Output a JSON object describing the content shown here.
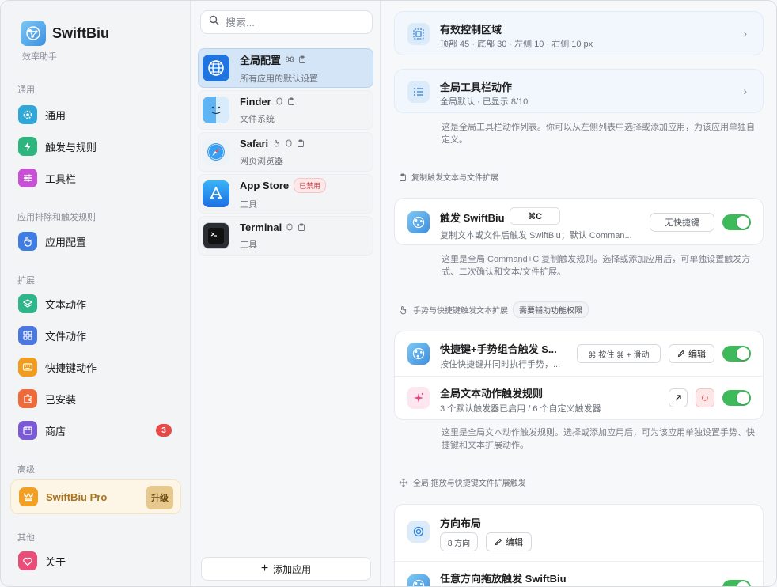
{
  "app": {
    "name": "SwiftBiu",
    "subtitle": "效率助手"
  },
  "sidebar": {
    "sections": [
      {
        "label": "通用"
      },
      {
        "label": "应用排除和触发规则"
      },
      {
        "label": "扩展"
      },
      {
        "label": "高级"
      },
      {
        "label": "其他"
      }
    ],
    "items": [
      {
        "label": "通用",
        "icon": "gear-icon",
        "color": "#2fa8d8"
      },
      {
        "label": "触发与规则",
        "icon": "bolt-icon",
        "color": "#2cb67d"
      },
      {
        "label": "工具栏",
        "icon": "sliders-icon",
        "color": "#c94fd6"
      },
      {
        "label": "应用配置",
        "icon": "hand-pointer-icon",
        "color": "#3f7de3"
      },
      {
        "label": "文本动作",
        "icon": "layers-icon",
        "color": "#2fb58a"
      },
      {
        "label": "文件动作",
        "icon": "grid-icon",
        "color": "#4a78e0"
      },
      {
        "label": "快捷键动作",
        "icon": "keyboard-icon",
        "color": "#f29c1f"
      },
      {
        "label": "已安装",
        "icon": "puzzle-icon",
        "color": "#ee6a3a"
      },
      {
        "label": "商店",
        "icon": "store-icon",
        "color": "#7a5ad6",
        "badge": "3"
      },
      {
        "label": "关于",
        "icon": "heart-icon",
        "color": "#ea4d77"
      }
    ],
    "pro": {
      "label": "SwiftBiu Pro",
      "upgrade": "升级"
    }
  },
  "applist": {
    "search_placeholder": "搜索...",
    "apps": [
      {
        "name": "全局配置",
        "sub": "所有应用的默认设置",
        "icon": "globe-icon",
        "selected": true
      },
      {
        "name": "Finder",
        "sub": "文件系统",
        "icon": "finder-icon"
      },
      {
        "name": "Safari",
        "sub": "网页浏览器",
        "icon": "safari-icon"
      },
      {
        "name": "App Store",
        "sub": "工具",
        "icon": "appstore-icon",
        "tag": "已禁用"
      },
      {
        "name": "Terminal",
        "sub": "工具",
        "icon": "terminal-icon"
      }
    ],
    "add_button": "添加应用"
  },
  "main": {
    "effective_area": {
      "title": "有效控制区域",
      "sub": "顶部 45 · 底部 30 · 左侧 10 · 右侧 10 px"
    },
    "toolbar_actions": {
      "title": "全局工具栏动作",
      "sub": "全局默认 · 已显示 8/10",
      "help": "这是全局工具栏动作列表。你可以从左侧列表中选择或添加应用，为该应用单独自定义。"
    },
    "copy_section": {
      "title": "复制触发文本与文件扩展"
    },
    "trigger": {
      "title": "触发 SwiftBiu",
      "shortcut": "⌘C",
      "sub": "复制文本或文件后触发 SwiftBiu；默认 Comman...",
      "no_shortcut": "无快捷键",
      "help": "这里是全局 Command+C 复制触发规则。选择或添加应用后，可单独设置触发方式、二次确认和文本/文件扩展。"
    },
    "gesture_section": {
      "title": "手势与快捷键触发文本扩展",
      "pill": "需要辅助功能权限"
    },
    "gesture_combo": {
      "title": "快捷键+手势组合触发 S...",
      "sub": "按住快捷键并同时执行手势，...",
      "hint": "⌘ 按住 ⌘ + 滑动",
      "edit": "编辑"
    },
    "text_rules": {
      "title": "全局文本动作触发规则",
      "sub": "3 个默认触发器已启用 / 6 个自定义触发器",
      "help": "这里是全局文本动作触发规则。选择或添加应用后，可为该应用单独设置手势、快捷键和文本扩展动作。"
    },
    "drag_section": {
      "title": "全局 拖放与快捷键文件扩展触发"
    },
    "direction": {
      "title": "方向布局",
      "count": "8 方向",
      "edit": "编辑"
    },
    "any_direction": {
      "title": "任意方向拖放触发 SwiftBiu"
    }
  }
}
